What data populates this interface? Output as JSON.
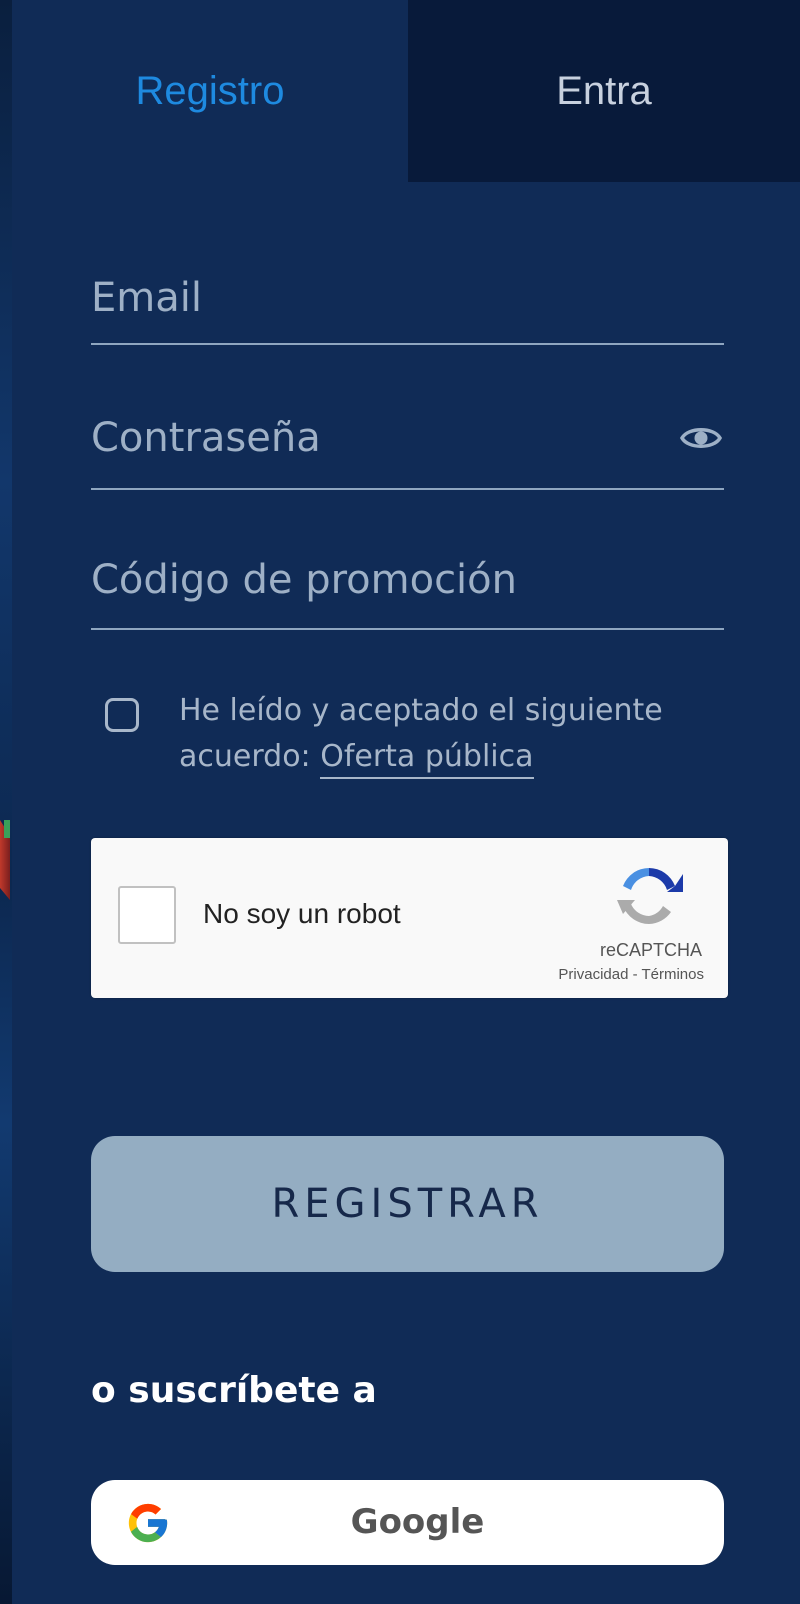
{
  "tabs": {
    "register_label": "Registro",
    "login_label": "Entra"
  },
  "form": {
    "email_placeholder": "Email",
    "password_placeholder": "Contraseña",
    "promo_placeholder": "Código de promoción",
    "password_toggle_icon": "eye-icon"
  },
  "consent": {
    "text": "He leído y aceptado el siguiente acuerdo: ",
    "link_label": "Oferta pública",
    "checked": false
  },
  "recaptcha": {
    "label": "No soy un robot",
    "brand": "reCAPTCHA",
    "links": "Privacidad - Términos",
    "checked": false
  },
  "actions": {
    "register_label": "REGISTRAR"
  },
  "social": {
    "heading": "o suscríbete a",
    "google_label": "Google",
    "google_icon": "google-logo-icon"
  },
  "colors": {
    "panel_bg": "#102b56",
    "inactive_tab_bg": "#081a3a",
    "active_tab_text": "#1e8ae0",
    "register_button_bg": "#94adc2"
  }
}
